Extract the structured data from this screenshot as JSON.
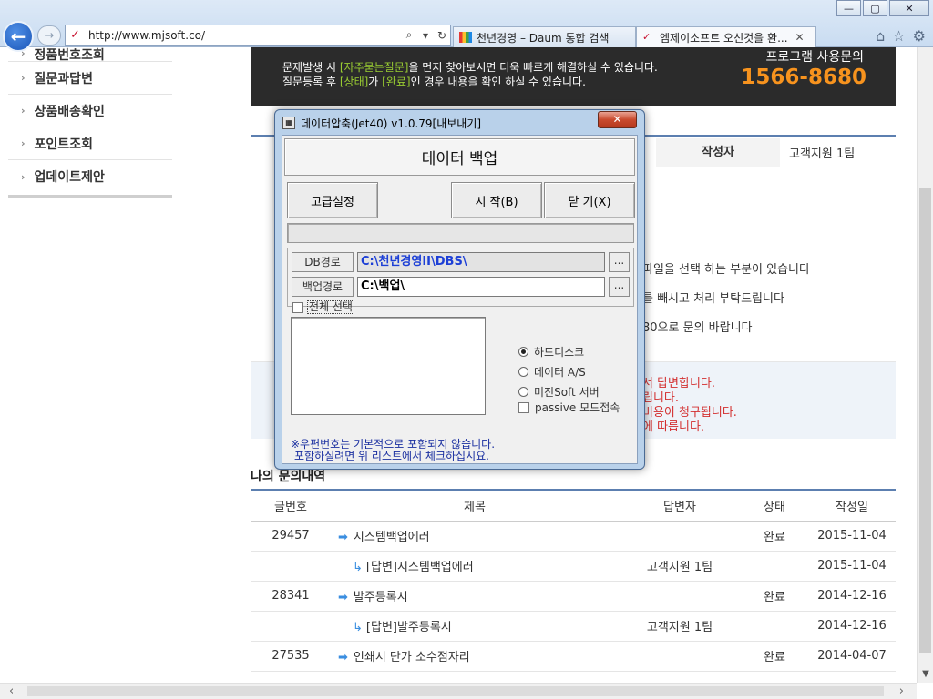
{
  "browser": {
    "url": "http://www.mjsoft.co/",
    "tabs": [
      {
        "label": "천년경영 – Daum 통합 검색",
        "active": false
      },
      {
        "label": "엠제이소프트 오신것을 환...",
        "active": true
      }
    ],
    "close_glyph": "✕",
    "window_controls": [
      "—",
      "▢",
      "✕"
    ]
  },
  "sidebar": {
    "items": [
      "정품번호조회",
      "질문과답변",
      "상품배송확인",
      "포인트조회",
      "업데이트제안"
    ]
  },
  "banner": {
    "line1_prefix": "문제발생 시 ",
    "line1_highlight": "[자주묻는질문]",
    "line1_suffix": "을 먼저 찾아보시면 더욱 빠르게 해결하실 수 있습니다.",
    "line2_prefix": "질문등록 후 ",
    "line2_highlight1": "[상태]",
    "line2_mid": "가 ",
    "line2_highlight2": "[완료]",
    "line2_suffix": "인 경우 내용을 확인 하실 수 있습니다.",
    "label": "프로그램 사용문의",
    "phone": "1566-8680"
  },
  "info": {
    "author_label": "작성자",
    "author_value": "고객지원 1팀",
    "lines": [
      "파일을 선택 하는 부분이 있습니다",
      "를 빼시고 처리 부탁드립니다",
      "80으로 문의 바랍니다"
    ],
    "red_lines": [
      "서 답변합니다.",
      "립니다.",
      "비용이 청구됩니다.",
      "에 따릅니다."
    ]
  },
  "inquiries": {
    "title": "나의 문의내역",
    "headers": {
      "num": "글번호",
      "title": "제목",
      "answerer": "답변자",
      "status": "상태",
      "date": "작성일"
    },
    "rows": [
      {
        "num": "29457",
        "title": "시스템백업에러",
        "answerer": "",
        "status": "완료",
        "date": "2015-11-04",
        "reply": false
      },
      {
        "num": "",
        "title": "[답변]시스템백업에러",
        "answerer": "고객지원 1팀",
        "status": "",
        "date": "2015-11-04",
        "reply": true
      },
      {
        "num": "28341",
        "title": "발주등록시",
        "answerer": "",
        "status": "완료",
        "date": "2014-12-16",
        "reply": false
      },
      {
        "num": "",
        "title": "[답변]발주등록시",
        "answerer": "고객지원 1팀",
        "status": "",
        "date": "2014-12-16",
        "reply": true
      },
      {
        "num": "27535",
        "title": "인쇄시 단가 소수점자리",
        "answerer": "",
        "status": "완료",
        "date": "2014-04-07",
        "reply": false
      }
    ]
  },
  "dialog": {
    "title": "데이터압축(Jet40) v1.0.79[내보내기]",
    "close_glyph": "✕",
    "header": "데이터 백업",
    "advanced_button": "고급설정",
    "start_button": "시 작(B)",
    "close_button": "닫 기(X)",
    "db_path_label": "DB경로",
    "db_path_value": "C:\\천년경영II\\DBS\\",
    "backup_path_label": "백업경로",
    "backup_path_value": "C:\\백업\\",
    "browse_label": "...",
    "select_all_label": "전체 선택",
    "options": [
      {
        "label": "하드디스크",
        "selected": true
      },
      {
        "label": "데이터 A/S",
        "selected": false
      },
      {
        "label": "미진Soft 서버",
        "selected": false
      }
    ],
    "passive_label": "passive 모드접속",
    "note_line1": "※우편번호는 기본적으로 포함되지 않습니다.",
    "note_line2": "포함하실려면 위 리스트에서 체크하십시요."
  }
}
